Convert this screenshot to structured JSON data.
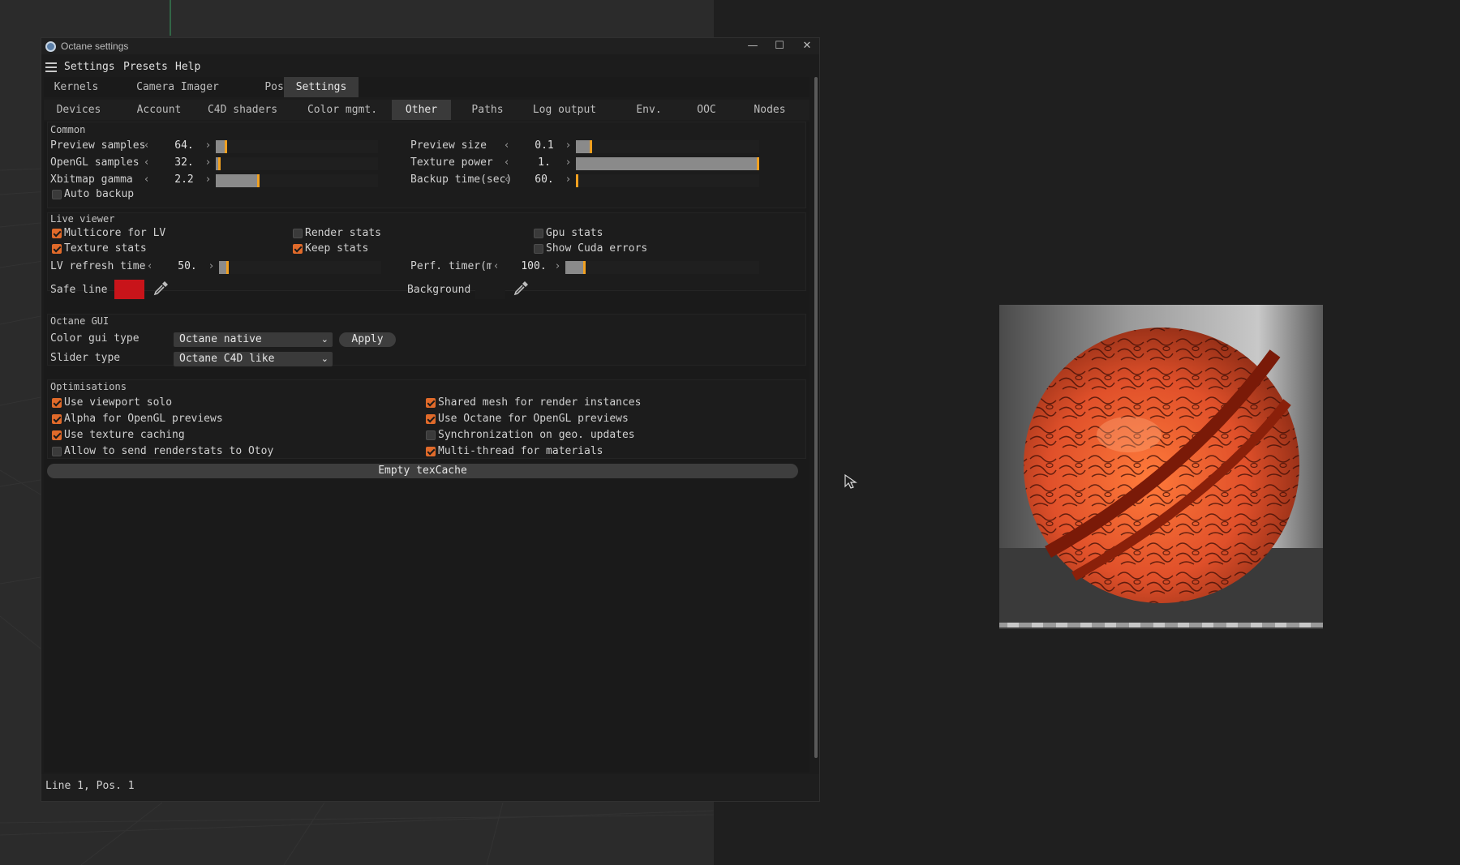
{
  "window": {
    "title": "Octane settings",
    "controls": [
      "—",
      "☐",
      "✕"
    ]
  },
  "menu": [
    "Settings",
    "Presets",
    "Help"
  ],
  "main_tabs": [
    {
      "label": "Kernels",
      "active": false
    },
    {
      "label": "Camera Imager",
      "active": false
    },
    {
      "label": "Post",
      "active": false
    },
    {
      "label": "Settings",
      "active": true
    }
  ],
  "sub_tabs": [
    {
      "label": "Devices",
      "active": false
    },
    {
      "label": "Account",
      "active": false
    },
    {
      "label": "C4D shaders",
      "active": false
    },
    {
      "label": "Color mgmt.",
      "active": false
    },
    {
      "label": "Other",
      "active": true
    },
    {
      "label": "Paths",
      "active": false
    },
    {
      "label": "Log output",
      "active": false
    },
    {
      "label": "Env.",
      "active": false
    },
    {
      "label": "OOC",
      "active": false
    },
    {
      "label": "Nodes",
      "active": false
    }
  ],
  "common": {
    "title": "Common",
    "fields": [
      {
        "label": "Preview samples",
        "value": "64.",
        "fill": 0.07
      },
      {
        "label": "OpenGL samples",
        "value": "32.",
        "fill": 0.03
      },
      {
        "label": "Xbitmap gamma",
        "value": "2.2",
        "fill": 0.27
      },
      {
        "label": "Preview size",
        "value": "0.1",
        "fill": 0.09
      },
      {
        "label": "Texture power",
        "value": "1.",
        "fill": 1.0
      },
      {
        "label": "Backup time(sec)",
        "value": "60.",
        "fill": 0.0
      }
    ],
    "auto_backup": {
      "label": "Auto backup",
      "checked": false
    }
  },
  "live_viewer": {
    "title": "Live viewer",
    "checks": [
      {
        "label": "Multicore for LV",
        "checked": true
      },
      {
        "label": "Texture stats",
        "checked": true
      },
      {
        "label": "Render stats",
        "checked": false
      },
      {
        "label": "Keep stats",
        "checked": true
      },
      {
        "label": "Gpu stats",
        "checked": false
      },
      {
        "label": "Show Cuda errors",
        "checked": false
      }
    ],
    "lv_refresh": {
      "label": "LV refresh time(m",
      "value": "50."
    },
    "perf_timer": {
      "label": "Perf. timer(m:",
      "value": "100."
    },
    "safe_line": {
      "label": "Safe line",
      "color": "#c8141a"
    },
    "background": {
      "label": "Background",
      "color": "#1c1c1c"
    }
  },
  "octane_gui": {
    "title": "Octane GUI",
    "color_gui_label": "Color gui type",
    "color_gui_value": "Octane native",
    "apply_label": "Apply",
    "slider_type_label": "Slider type",
    "slider_type_value": "Octane C4D like"
  },
  "optimisations": {
    "title": "Optimisations",
    "checks": [
      {
        "label": "Use viewport solo",
        "checked": true
      },
      {
        "label": "Alpha for OpenGL previews",
        "checked": true
      },
      {
        "label": "Use texture caching",
        "checked": true
      },
      {
        "label": "Allow to send renderstats to Otoy",
        "checked": false
      },
      {
        "label": "Shared mesh for render instances",
        "checked": true
      },
      {
        "label": "Use Octane for OpenGL previews",
        "checked": true
      },
      {
        "label": "Synchronization on geo. updates",
        "checked": false
      },
      {
        "label": "Multi-thread for materials",
        "checked": true
      }
    ]
  },
  "empty_texcache_label": "Empty texCache",
  "status": "Line 1, Pos. 1",
  "colors": {
    "accent": "#e06a2a",
    "slider_marker": "#f0a020",
    "preview_sphere": "#e0502a"
  }
}
